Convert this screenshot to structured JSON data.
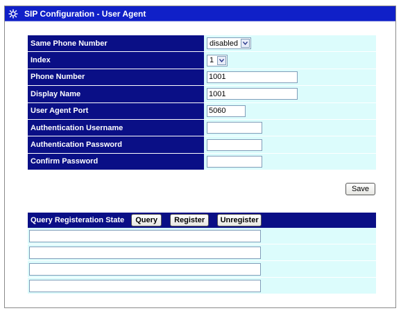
{
  "window": {
    "title": "SIP Configuration - User Agent",
    "icon": "gear-icon"
  },
  "config_rows": [
    {
      "label": "Same Phone Number",
      "type": "select",
      "value": "disabled"
    },
    {
      "label": "Index",
      "type": "select",
      "value": "1"
    },
    {
      "label": "Phone Number",
      "type": "text",
      "value": "1001"
    },
    {
      "label": "Display Name",
      "type": "text",
      "value": "1001"
    },
    {
      "label": "User Agent Port",
      "type": "text",
      "value": "5060"
    },
    {
      "label": "Authentication Username",
      "type": "text",
      "value": ""
    },
    {
      "label": "Authentication Password",
      "type": "password",
      "value": ""
    },
    {
      "label": "Confirm Password",
      "type": "password",
      "value": ""
    }
  ],
  "save_label": "Save",
  "query": {
    "label": "Query Registeration State",
    "buttons": {
      "query": "Query",
      "register": "Register",
      "unregister": "Unregister"
    },
    "results": [
      "",
      "",
      "",
      ""
    ]
  },
  "colors": {
    "title_bar": "#1020c8",
    "label_bg": "#0a0f86",
    "value_bg": "#dcfcfc"
  }
}
